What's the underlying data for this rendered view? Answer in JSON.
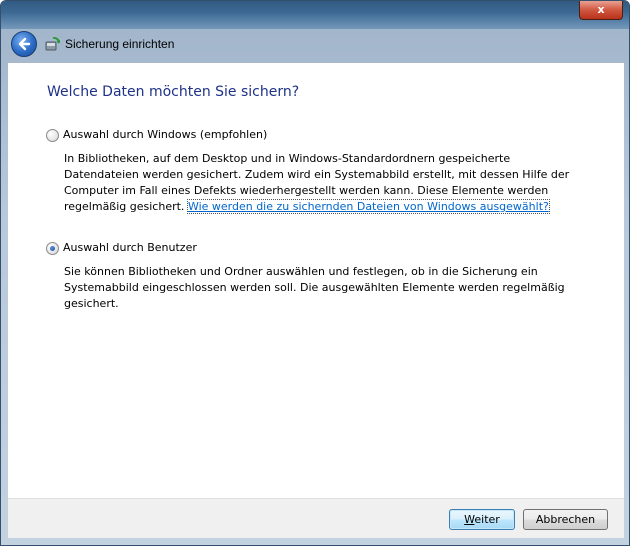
{
  "window": {
    "close_glyph": "x",
    "nav_title": "Sicherung einrichten",
    "back_icon": "back-arrow-icon",
    "app_icon": "backup-icon"
  },
  "content": {
    "heading": "Welche Daten möchten Sie sichern?",
    "options": [
      {
        "label": "Auswahl durch Windows (empfohlen)",
        "selected": false,
        "description": "In Bibliotheken, auf dem Desktop und in Windows-Standardordnern gespeicherte Datendateien werden gesichert. Zudem wird ein Systemabbild erstellt, mit dessen Hilfe der Computer im Fall eines Defekts wiederhergestellt werden kann. Diese Elemente werden regelmäßig gesichert.",
        "link_text": "Wie werden die zu sichernden Dateien von Windows ausgewählt?"
      },
      {
        "label": "Auswahl durch Benutzer",
        "selected": true,
        "description": "Sie können Bibliotheken und Ordner auswählen und festlegen, ob in die Sicherung ein Systemabbild eingeschlossen werden soll. Die ausgewählten Elemente werden regelmäßig gesichert."
      }
    ]
  },
  "footer": {
    "next_button_accel": "W",
    "next_button_rest": "eiter",
    "cancel_button": "Abbrechen"
  },
  "colors": {
    "heading": "#1e3287",
    "link": "#0066cc",
    "default_button_border": "#3c7fb1"
  }
}
